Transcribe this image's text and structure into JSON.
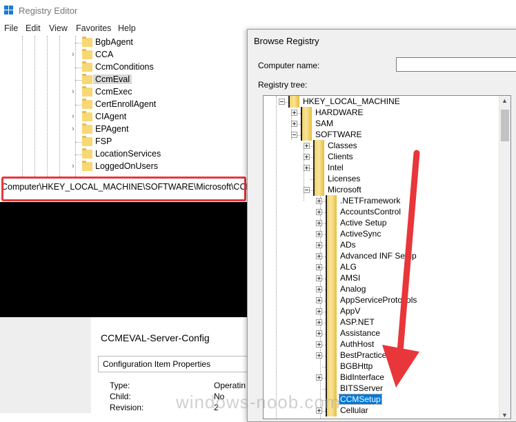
{
  "registry_editor": {
    "title": "Registry Editor",
    "menu": [
      "File",
      "Edit",
      "View",
      "Favorites",
      "Help"
    ],
    "tree_items": [
      {
        "label": "BgbAgent",
        "expandable": false,
        "selected": false
      },
      {
        "label": "CCA",
        "expandable": true,
        "selected": false
      },
      {
        "label": "CcmConditions",
        "expandable": false,
        "selected": false
      },
      {
        "label": "CcmEval",
        "expandable": false,
        "selected": true
      },
      {
        "label": "CcmExec",
        "expandable": true,
        "selected": false
      },
      {
        "label": "CertEnrollAgent",
        "expandable": false,
        "selected": false
      },
      {
        "label": "CIAgent",
        "expandable": true,
        "selected": false
      },
      {
        "label": "EPAgent",
        "expandable": true,
        "selected": false
      },
      {
        "label": "FSP",
        "expandable": false,
        "selected": false
      },
      {
        "label": "LocationServices",
        "expandable": false,
        "selected": false
      },
      {
        "label": "LoggedOnUsers",
        "expandable": true,
        "selected": false
      }
    ],
    "address": "Computer\\HKEY_LOCAL_MACHINE\\SOFTWARE\\Microsoft\\CCM\\Cc",
    "highlight_color": "#e8363a"
  },
  "properties_panel": {
    "title": "CCMEVAL-Server-Config",
    "section": "Configuration Item Properties",
    "rows": [
      {
        "label": "Type:",
        "value": "Operatin"
      },
      {
        "label": "Child:",
        "value": "No"
      },
      {
        "label": "Revision:",
        "value": "2"
      }
    ]
  },
  "browse_dialog": {
    "title": "Browse Registry",
    "computer_label": "Computer name:",
    "computer_value": "",
    "tree_label": "Registry tree:",
    "root": "HKEY_LOCAL_MACHINE",
    "hive_children": [
      "HARDWARE",
      "SAM",
      "SOFTWARE"
    ],
    "software_children": [
      "Classes",
      "Clients",
      "Intel",
      "Licenses",
      "Microsoft"
    ],
    "microsoft_children": [
      ".NETFramework",
      "AccountsControl",
      "Active Setup",
      "ActiveSync",
      "ADs",
      "Advanced INF Setup",
      "ALG",
      "AMSI",
      "Analog",
      "AppServiceProtocols",
      "AppV",
      "ASP.NET",
      "Assistance",
      "AuthHost",
      "BestPractices",
      "BGBHttp",
      "BidInterface",
      "BITSServer",
      "CCMSetup",
      "Cellular"
    ],
    "selected": "CCMSetup",
    "selection_color": "#0078d7"
  },
  "annotation_arrow_color": "#e8363a",
  "watermark": "windows-noob.com"
}
